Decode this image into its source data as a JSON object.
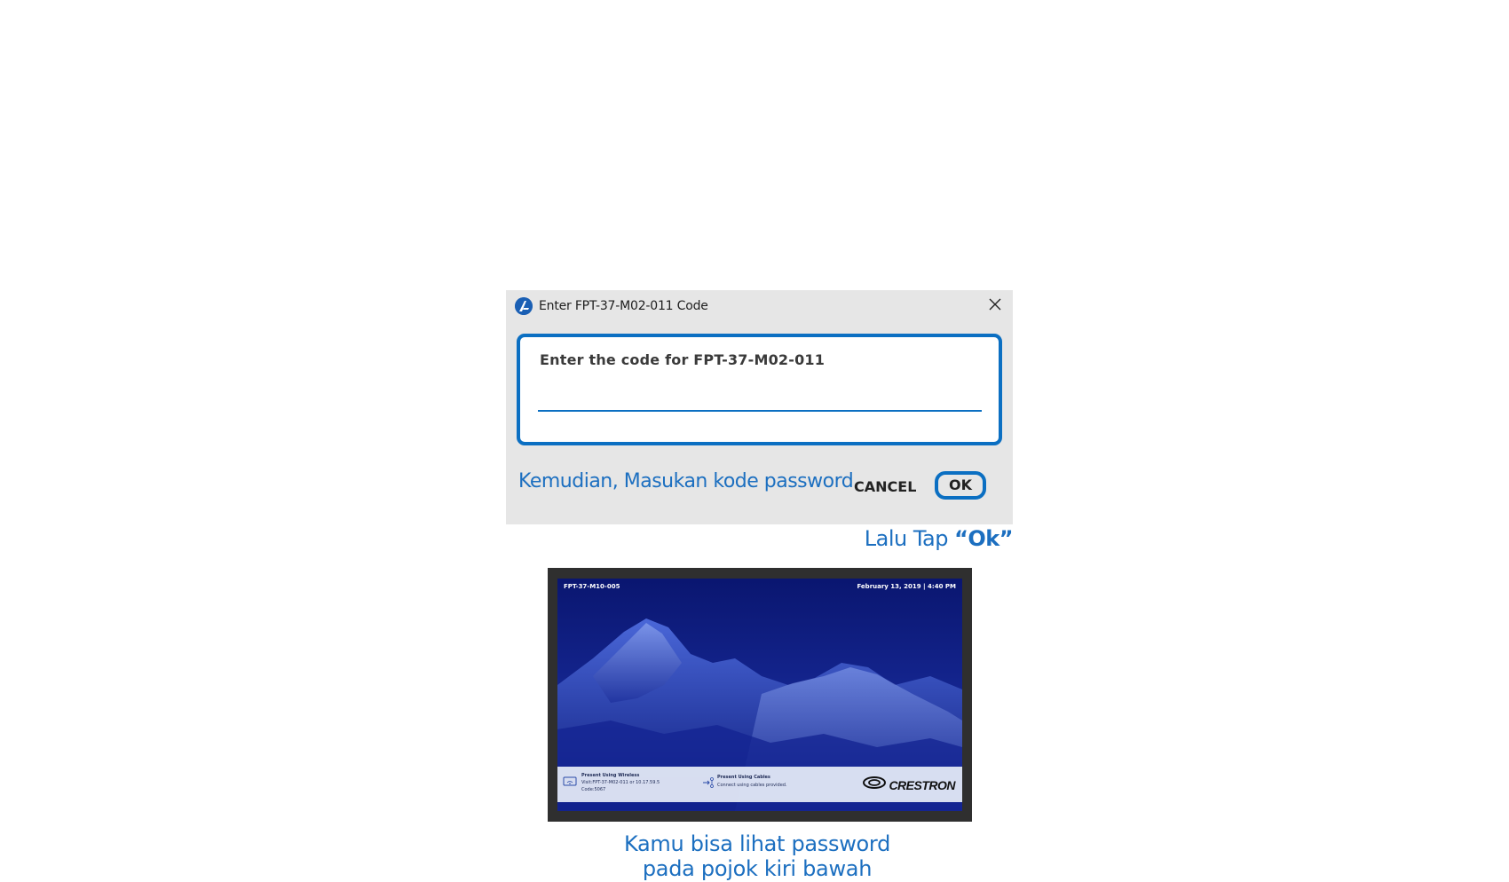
{
  "dialog": {
    "title": "Enter FPT-37-M02-011 Code",
    "code_label": "Enter the code for FPT-37-M02-011",
    "code_value": "",
    "cancel_label": "CANCEL",
    "ok_label": "OK",
    "instruction": "Kemudian, Masukan kode password",
    "icons": {
      "app": "app-logo-icon",
      "close": "close-icon"
    }
  },
  "tap_hint": {
    "prefix": "Lalu Tap ",
    "emphasis": "“Ok”"
  },
  "display": {
    "room_name": "FPT-37-M10-005",
    "date_time": "February 13, 2019 | 4:40 PM",
    "wireless": {
      "title": "Present Using Wireless",
      "visit": "Visit:FPT-37-M02-011 or 10.17.59.5",
      "code": "Code:5067"
    },
    "cables": {
      "title": "Present Using Cables",
      "detail": "Connect using cables provided."
    },
    "brand": "CRESTRON",
    "icons": {
      "wireless": "wireless-present-icon",
      "cables": "cable-present-icon",
      "brand": "crestron-logo-icon"
    }
  },
  "caption": {
    "line1": "Kamu bisa lihat password",
    "line2": "pada pojok kiri bawah"
  },
  "colors": {
    "accent": "#0b6fc2",
    "caption_blue": "#1c6fc0",
    "dialog_bg": "#e6e6e6",
    "screen_bg": "#0a1a6b"
  }
}
